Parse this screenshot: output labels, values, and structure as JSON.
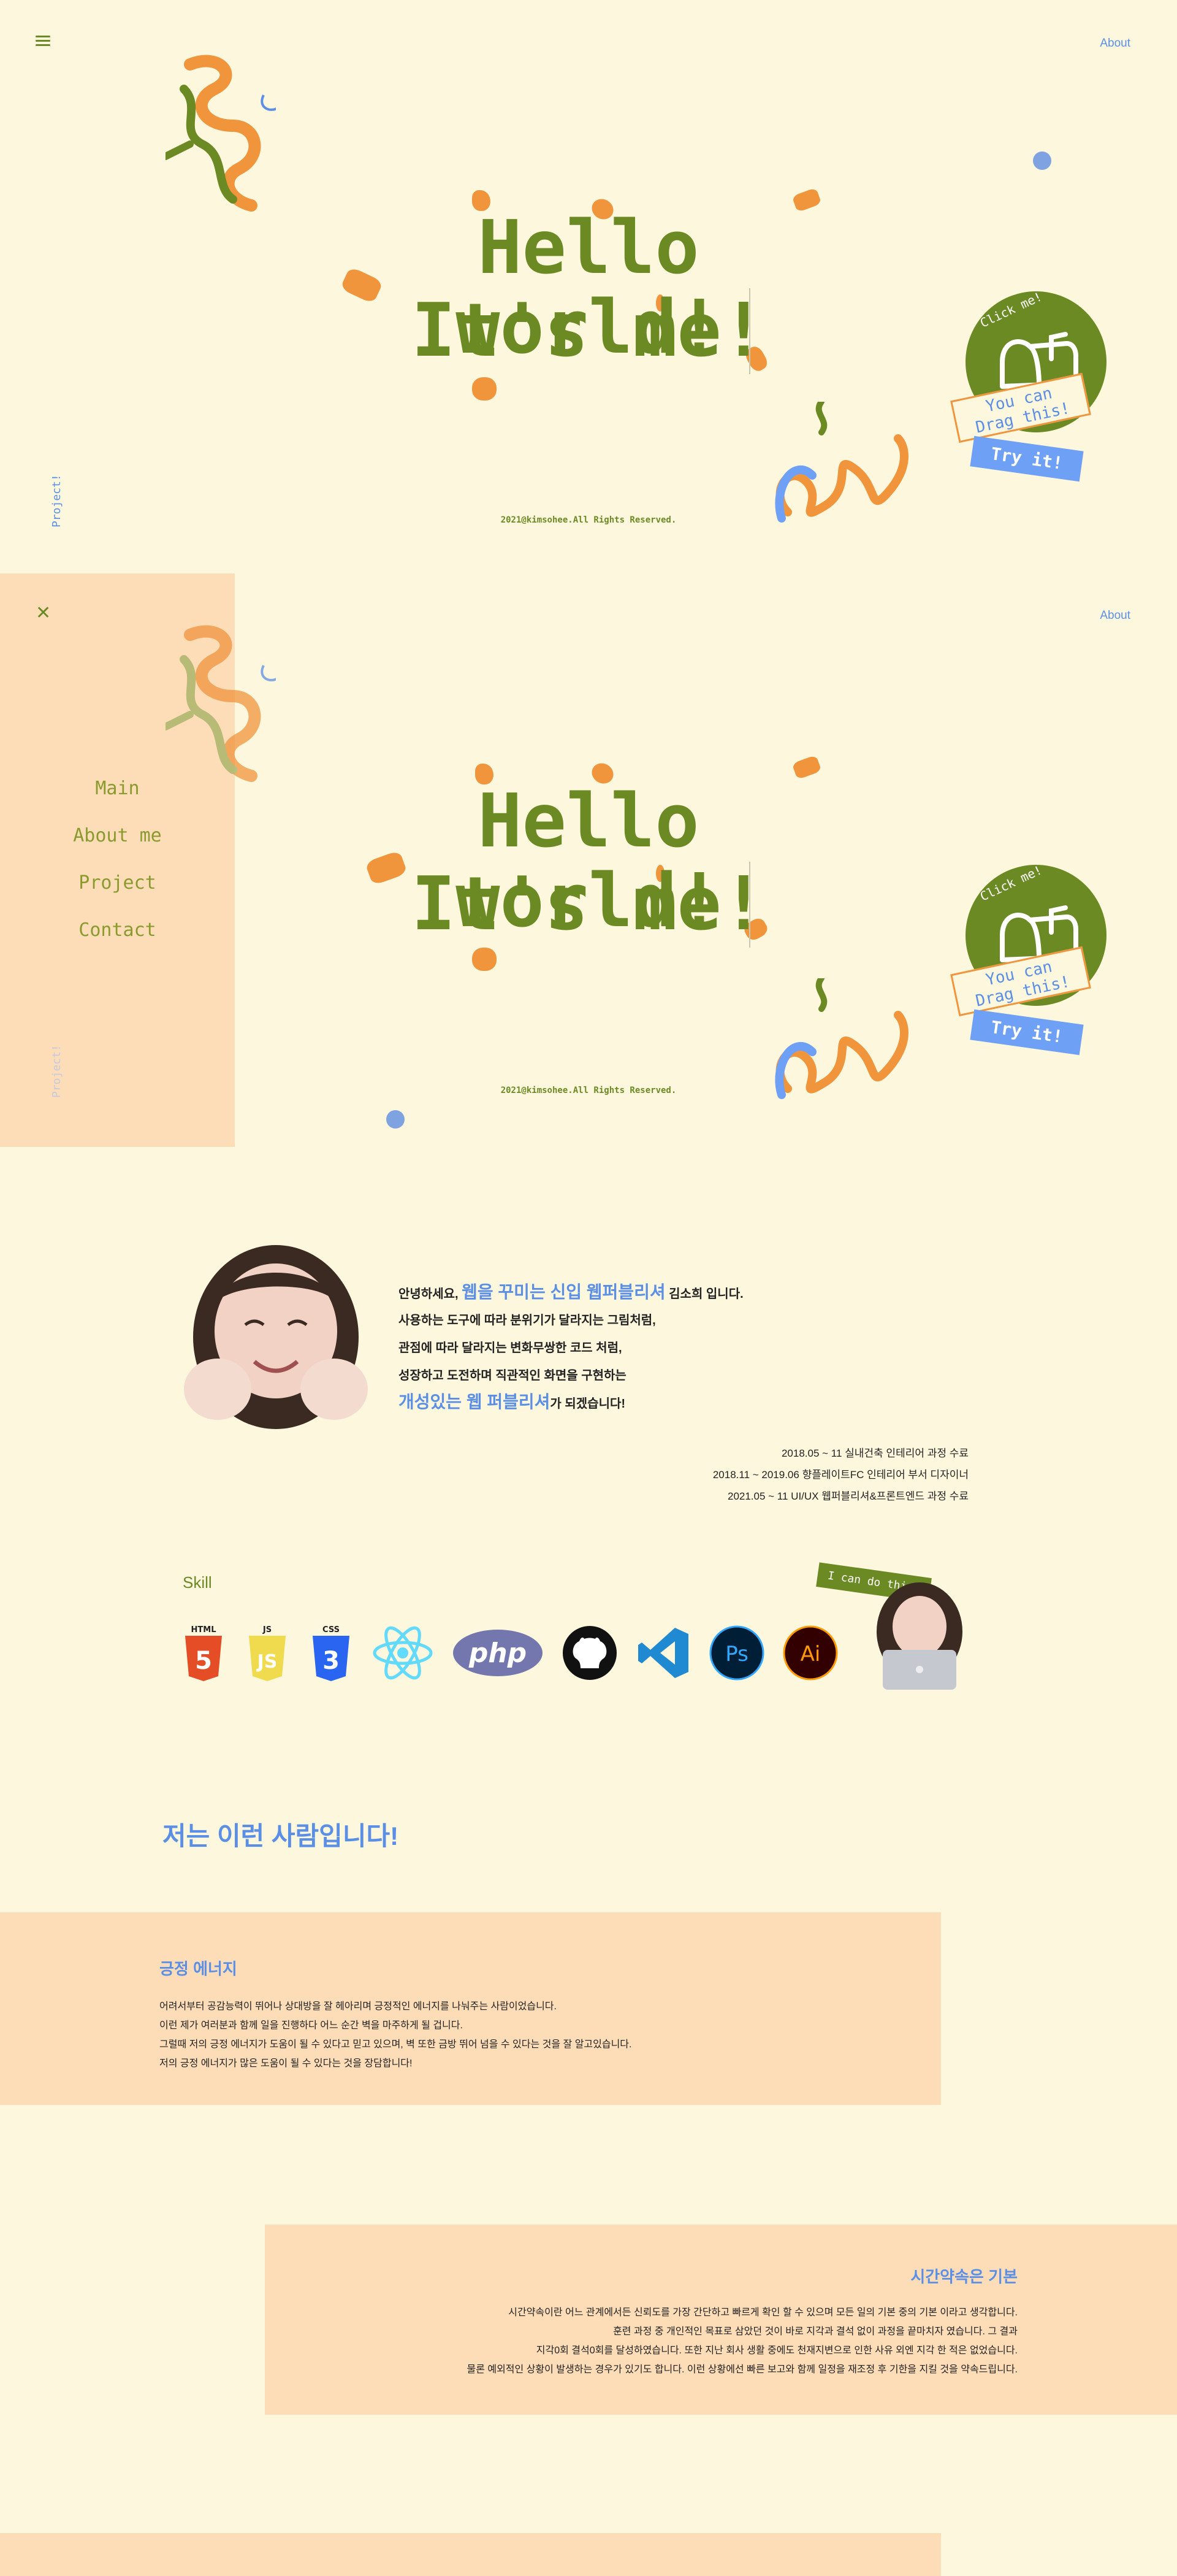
{
  "hero": {
    "about": "About",
    "title_line1": "Hello world!",
    "title_line2": "It's me!",
    "copyright": "2021@kimsohee.All Rights Reserved.",
    "vertical_label": "Project!",
    "sticker_click": "Click me!",
    "sticker_drag_1": "You can",
    "sticker_drag_2": "Drag this!",
    "sticker_try": "Try it!"
  },
  "menu": {
    "items": [
      "Main",
      "About me",
      "Project",
      "Contact"
    ],
    "vertical_label": "Project!"
  },
  "intro": {
    "line1_pre": "안녕하세요, ",
    "line1_hl": "웹을 꾸미는 신입 웹퍼블리셔",
    "line1_post": " 김소희 입니다.",
    "line2": "사용하는 도구에 따라 분위기가 달라지는 그림처럼,",
    "line3": "관점에 따라 달라지는 변화무쌍한 코드 처럼,",
    "line4": "성장하고 도전하며 직관적인 화면을 구현하는",
    "line5_hl": "개성있는 웹 퍼블리셔",
    "line5_post": "가 되겠습니다!",
    "history": [
      "2018.05 ~ 11 실내건축 인테리어 과정 수료",
      "2018.11 ~ 2019.06 향플레이트FC 인테리어 부서 디자이너",
      "2021.05 ~ 11 UI/UX 웹퍼블리셔&프론트엔드 과정 수료"
    ]
  },
  "skills": {
    "title": "Skill",
    "sticker": "I can do this!",
    "items": [
      {
        "name": "html-icon",
        "label": "HTML",
        "digit": "5",
        "color": "#e44d26"
      },
      {
        "name": "js-icon",
        "label": "JS",
        "digit": "JS",
        "color": "#f0db4f"
      },
      {
        "name": "css-icon",
        "label": "CSS",
        "digit": "3",
        "color": "#2965f1"
      },
      {
        "name": "react-icon",
        "label": "",
        "digit": "",
        "color": "#61dafb"
      },
      {
        "name": "php-icon",
        "label": "php",
        "digit": "",
        "color": "#7377ad"
      },
      {
        "name": "github-icon",
        "label": "",
        "digit": "",
        "color": "#111111"
      },
      {
        "name": "vscode-icon",
        "label": "",
        "digit": "",
        "color": "#1f8ad2"
      },
      {
        "name": "photoshop-icon",
        "label": "Ps",
        "digit": "",
        "color": "#001e36"
      },
      {
        "name": "illustrator-icon",
        "label": "Ai",
        "digit": "",
        "color": "#330000"
      }
    ]
  },
  "people": {
    "title": "저는 이런 사람입니다!",
    "card1": {
      "title": "긍정 에너지",
      "lines": [
        "어려서부터 공감능력이 뛰어나 상대방을 잘 헤아리며 긍정적인 에너지를 나눠주는 사람이었습니다.",
        "이런 제가 여러분과 함께 일을 진행하다 어느 순간 벽을 마주하게 될 겁니다.",
        "그럴때 저의 긍정 에너지가 도움이 될 수 있다고 믿고 있으며, 벽 또한 금방 뛰어 넘을 수 있다는 것을 잘 알고있습니다.",
        "저의 긍정 에너지가 많은 도움이 될 수 있다는 것을 장담합니다!"
      ]
    },
    "card2": {
      "title": "시간약속은 기본",
      "lines": [
        "시간약속이란 어느 관계에서든 신뢰도를 가장 간단하고 빠르게 확인 할 수 있으며 모든 일의 기본 중의 기본 이라고 생각합니다.",
        "훈련 과정 중 개인적인 목표로 삼았던 것이 바로 지각과 결석 없이 과정을 끝마치자 였습니다. 그 결과",
        "지각0회 결석0회를 달성하였습니다. 또한 지난 회사 생활 중에도 천재지변으로 인한 사유 외엔 지각 한 적은 없었습니다.",
        "물론 예외적인 상황이 발생하는 경우가 있기도 합니다. 이런 상황에선 빠른 보고와 함께 일정을 재조정 후 기한을 지킬 것을 약속드립니다."
      ]
    }
  },
  "colors": {
    "background": "#fdf7dd",
    "green": "#6b8a24",
    "blue": "#5b8fe6",
    "peach": "#fddcb8",
    "orange": "#f0953c"
  }
}
